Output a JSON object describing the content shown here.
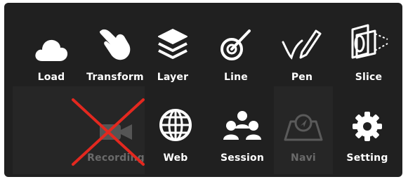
{
  "toolbar": {
    "items": [
      {
        "id": "load",
        "label": "Load",
        "icon": "cloud-icon",
        "enabled": true
      },
      {
        "id": "transform",
        "label": "Transform",
        "icon": "hand-pointer-icon",
        "enabled": true
      },
      {
        "id": "layer",
        "label": "Layer",
        "icon": "layers-icon",
        "enabled": true
      },
      {
        "id": "line",
        "label": "Line",
        "icon": "line-target-icon",
        "enabled": true
      },
      {
        "id": "pen",
        "label": "Pen",
        "icon": "pen-icon",
        "enabled": true
      },
      {
        "id": "slice",
        "label": "Slice",
        "icon": "slice-cube-icon",
        "enabled": true
      },
      {
        "id": "recording",
        "label": "Recording",
        "icon": "video-camera-icon",
        "enabled": false,
        "crossed_out": true
      },
      {
        "id": "web",
        "label": "Web",
        "icon": "globe-icon",
        "enabled": true
      },
      {
        "id": "session",
        "label": "Session",
        "icon": "users-icon",
        "enabled": true
      },
      {
        "id": "navi",
        "label": "Navi",
        "icon": "navigation-map-icon",
        "enabled": false
      },
      {
        "id": "setting",
        "label": "Setting",
        "icon": "gear-icon",
        "enabled": true
      }
    ]
  },
  "colors": {
    "panel_bg": "#202020",
    "label_enabled": "#ffffff",
    "label_disabled": "#6a6a6a",
    "cross": "#e3281f"
  }
}
